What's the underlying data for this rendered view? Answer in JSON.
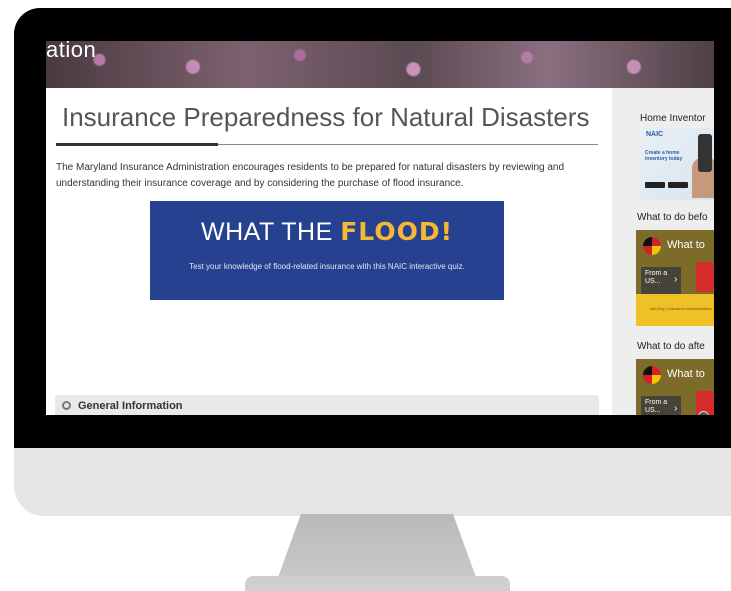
{
  "hero": {
    "title": "ation"
  },
  "main": {
    "page_title": "Insurance Preparedness for Natural Disasters",
    "intro": "The Maryland Insurance Administration encourages residents to be prepared for natural disasters by reviewing and understanding their insurance coverage and by considering the purchase of flood insurance.",
    "quiz": {
      "heading_light": "WHAT THE ",
      "heading_bold": "FLOOD!",
      "subtext": "Test your knowledge of flood-related insurance with this NAIC interactive quiz."
    },
    "accordion": {
      "label": "General Information"
    }
  },
  "sidebar": {
    "home_inventory_heading": "Home Inventor",
    "naic_card": {
      "logo": "NAIC",
      "text": "Create a home inventory today"
    },
    "before_heading": "What to do befo",
    "after_heading": "What to do afte",
    "videos": [
      {
        "title": "What to",
        "from": "From a US...",
        "footer": "mid-Day | Insurance Administration"
      },
      {
        "title": "What to",
        "from": "From a US..."
      }
    ]
  },
  "colors": {
    "quiz_bg": "#26418f",
    "quiz_accent": "#f5b833",
    "video_bg": "#f0c127"
  }
}
